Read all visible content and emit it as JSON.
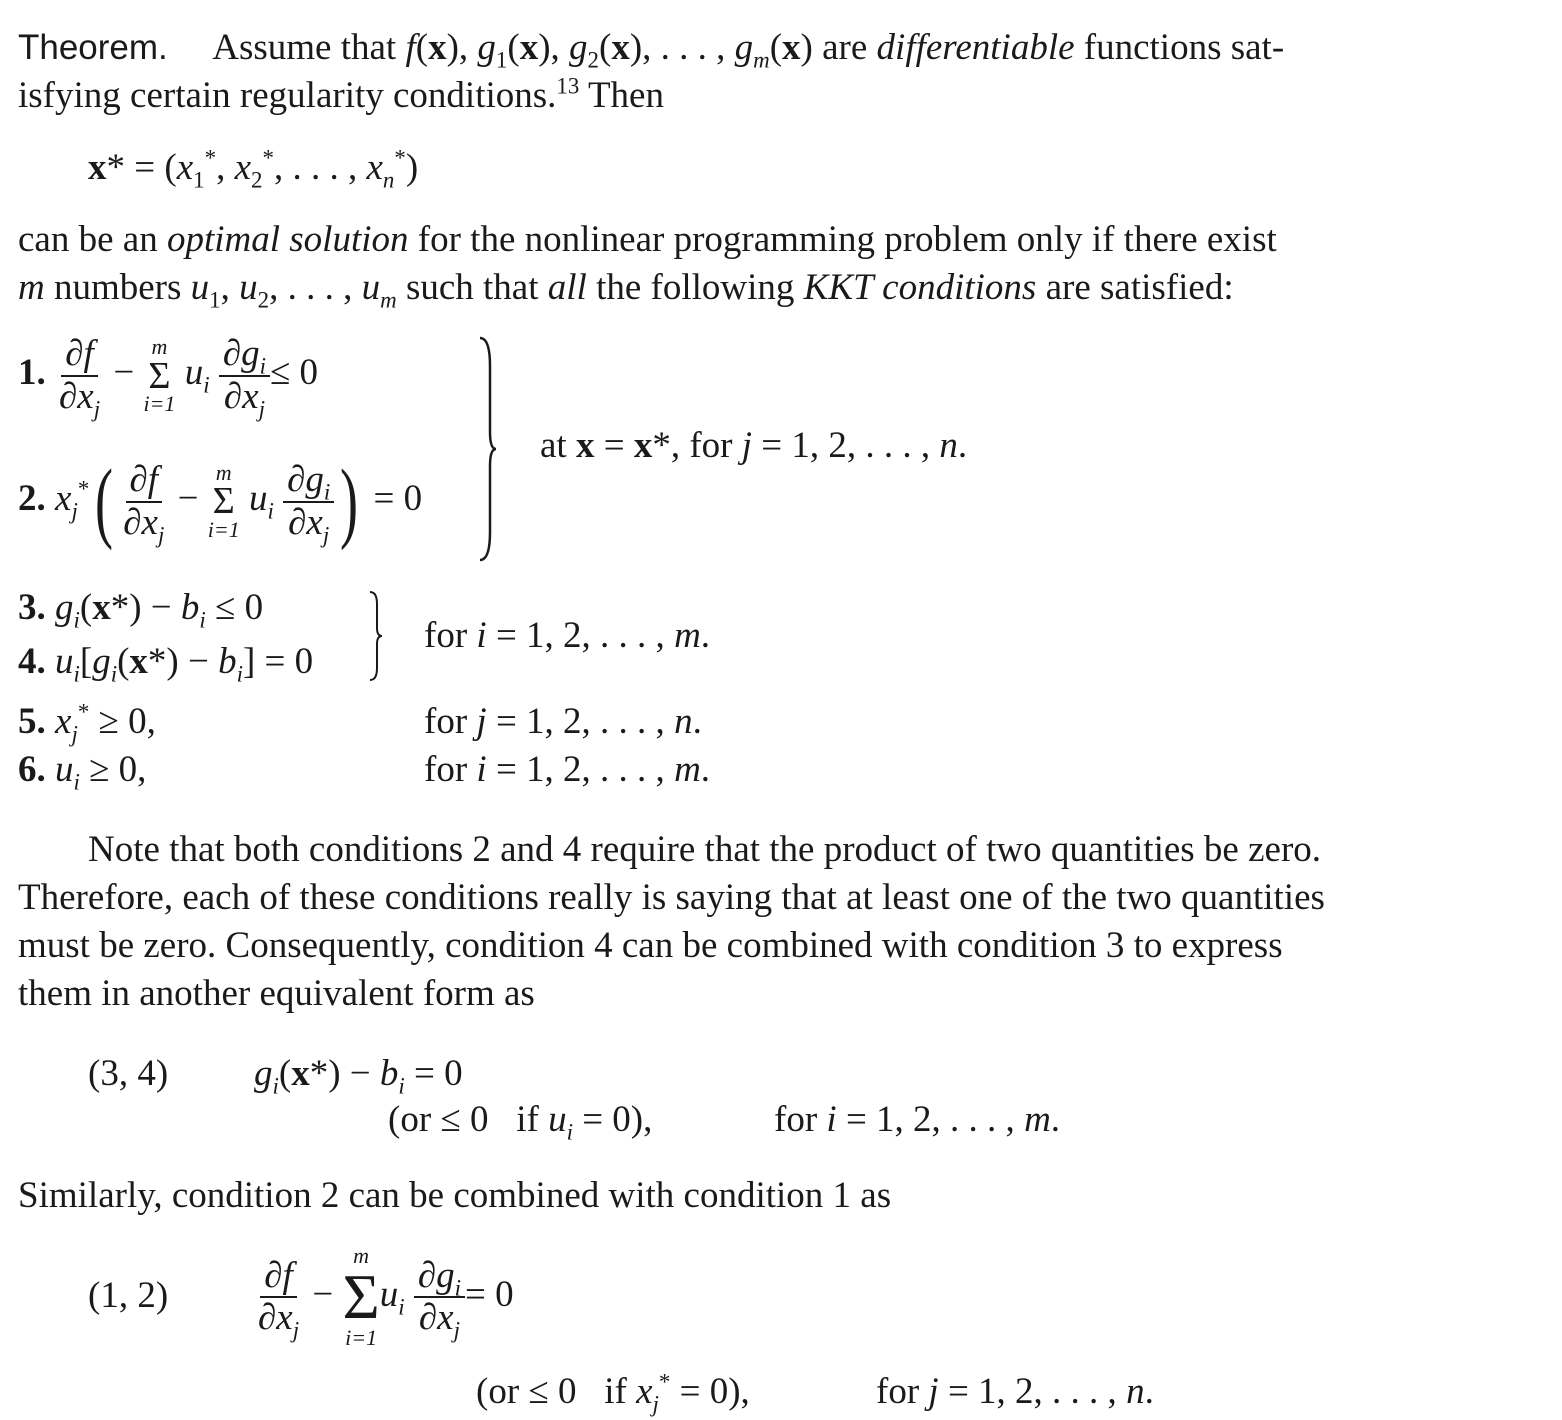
{
  "theorem": {
    "label": "Theorem.",
    "intro_line1_a": "Assume that ",
    "intro_line1_b": " are ",
    "differentiable": "differentiable",
    "intro_line1_c": " functions sat-",
    "intro_line2": "isfying certain regularity conditions.",
    "footnote": "13",
    "intro_line2_end": " Then",
    "x_star_def": "x* = (x₁*, x₂*, . . . , xₙ*)",
    "para2_line1_a": "can be an ",
    "optimal_solution": "optimal solution",
    "para2_line1_b": " for the nonlinear programming problem only if there exist",
    "para2_line2_a": " numbers ",
    "para2_line2_b": " such that ",
    "all": "all",
    "para2_line2_c": " the following ",
    "kkt": "KKT conditions",
    "para2_line2_d": " are satisfied:"
  },
  "conditions": [
    {
      "num": "1.",
      "text": "∂f/∂xj − Σ(i=1..m) ui ∂gi/∂xj ≤ 0"
    },
    {
      "num": "2.",
      "text": "xj*(∂f/∂xj − Σ(i=1..m) ui ∂gi/∂xj) = 0"
    },
    {
      "num": "3.",
      "text": "gi(x*) − bi ≤ 0"
    },
    {
      "num": "4.",
      "text": "ui[gi(x*) − bi] = 0"
    },
    {
      "num": "5.",
      "text": "xj* ≥ 0,"
    },
    {
      "num": "6.",
      "text": "ui ≥ 0,"
    }
  ],
  "qualifiers": {
    "c12": "at x = x*, for j = 1, 2, . . . , n.",
    "c34": "for i = 1, 2, . . . , m.",
    "c5": "for j = 1, 2, . . . , n.",
    "c6": "for i = 1, 2, . . . , m."
  },
  "note": {
    "line1": "Note that both conditions 2 and 4 require that the product of two quantities be zero.",
    "line2": "Therefore, each of these conditions really is saying that at least one of the two quantities",
    "line3": "must be zero. Consequently, condition 4 can be combined with condition 3 to express",
    "line4": "them in another equivalent form as"
  },
  "combined34": {
    "label": "(3, 4)",
    "equation": "gi(x*) − bi = 0",
    "alt": "(or ≤ 0   if ui = 0),",
    "range": "for i = 1, 2, . . . , m."
  },
  "similarly": "Similarly, condition 2 can be combined with condition 1 as",
  "combined12": {
    "label": "(1, 2)",
    "equation": "∂f/∂xj − Σ(i=1..m) ui ∂gi/∂xj = 0",
    "alt": "(or ≤ 0   if xj* = 0),",
    "range": "for j = 1, 2, . . . , n."
  }
}
